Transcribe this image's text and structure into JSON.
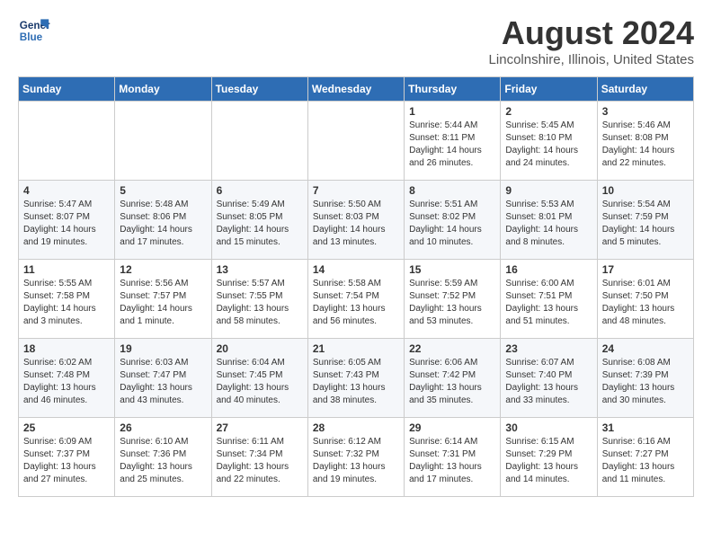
{
  "logo": {
    "line1": "General",
    "line2": "Blue"
  },
  "title": "August 2024",
  "location": "Lincolnshire, Illinois, United States",
  "days_of_week": [
    "Sunday",
    "Monday",
    "Tuesday",
    "Wednesday",
    "Thursday",
    "Friday",
    "Saturday"
  ],
  "weeks": [
    [
      {
        "day": "",
        "info": ""
      },
      {
        "day": "",
        "info": ""
      },
      {
        "day": "",
        "info": ""
      },
      {
        "day": "",
        "info": ""
      },
      {
        "day": "1",
        "info": "Sunrise: 5:44 AM\nSunset: 8:11 PM\nDaylight: 14 hours\nand 26 minutes."
      },
      {
        "day": "2",
        "info": "Sunrise: 5:45 AM\nSunset: 8:10 PM\nDaylight: 14 hours\nand 24 minutes."
      },
      {
        "day": "3",
        "info": "Sunrise: 5:46 AM\nSunset: 8:08 PM\nDaylight: 14 hours\nand 22 minutes."
      }
    ],
    [
      {
        "day": "4",
        "info": "Sunrise: 5:47 AM\nSunset: 8:07 PM\nDaylight: 14 hours\nand 19 minutes."
      },
      {
        "day": "5",
        "info": "Sunrise: 5:48 AM\nSunset: 8:06 PM\nDaylight: 14 hours\nand 17 minutes."
      },
      {
        "day": "6",
        "info": "Sunrise: 5:49 AM\nSunset: 8:05 PM\nDaylight: 14 hours\nand 15 minutes."
      },
      {
        "day": "7",
        "info": "Sunrise: 5:50 AM\nSunset: 8:03 PM\nDaylight: 14 hours\nand 13 minutes."
      },
      {
        "day": "8",
        "info": "Sunrise: 5:51 AM\nSunset: 8:02 PM\nDaylight: 14 hours\nand 10 minutes."
      },
      {
        "day": "9",
        "info": "Sunrise: 5:53 AM\nSunset: 8:01 PM\nDaylight: 14 hours\nand 8 minutes."
      },
      {
        "day": "10",
        "info": "Sunrise: 5:54 AM\nSunset: 7:59 PM\nDaylight: 14 hours\nand 5 minutes."
      }
    ],
    [
      {
        "day": "11",
        "info": "Sunrise: 5:55 AM\nSunset: 7:58 PM\nDaylight: 14 hours\nand 3 minutes."
      },
      {
        "day": "12",
        "info": "Sunrise: 5:56 AM\nSunset: 7:57 PM\nDaylight: 14 hours\nand 1 minute."
      },
      {
        "day": "13",
        "info": "Sunrise: 5:57 AM\nSunset: 7:55 PM\nDaylight: 13 hours\nand 58 minutes."
      },
      {
        "day": "14",
        "info": "Sunrise: 5:58 AM\nSunset: 7:54 PM\nDaylight: 13 hours\nand 56 minutes."
      },
      {
        "day": "15",
        "info": "Sunrise: 5:59 AM\nSunset: 7:52 PM\nDaylight: 13 hours\nand 53 minutes."
      },
      {
        "day": "16",
        "info": "Sunrise: 6:00 AM\nSunset: 7:51 PM\nDaylight: 13 hours\nand 51 minutes."
      },
      {
        "day": "17",
        "info": "Sunrise: 6:01 AM\nSunset: 7:50 PM\nDaylight: 13 hours\nand 48 minutes."
      }
    ],
    [
      {
        "day": "18",
        "info": "Sunrise: 6:02 AM\nSunset: 7:48 PM\nDaylight: 13 hours\nand 46 minutes."
      },
      {
        "day": "19",
        "info": "Sunrise: 6:03 AM\nSunset: 7:47 PM\nDaylight: 13 hours\nand 43 minutes."
      },
      {
        "day": "20",
        "info": "Sunrise: 6:04 AM\nSunset: 7:45 PM\nDaylight: 13 hours\nand 40 minutes."
      },
      {
        "day": "21",
        "info": "Sunrise: 6:05 AM\nSunset: 7:43 PM\nDaylight: 13 hours\nand 38 minutes."
      },
      {
        "day": "22",
        "info": "Sunrise: 6:06 AM\nSunset: 7:42 PM\nDaylight: 13 hours\nand 35 minutes."
      },
      {
        "day": "23",
        "info": "Sunrise: 6:07 AM\nSunset: 7:40 PM\nDaylight: 13 hours\nand 33 minutes."
      },
      {
        "day": "24",
        "info": "Sunrise: 6:08 AM\nSunset: 7:39 PM\nDaylight: 13 hours\nand 30 minutes."
      }
    ],
    [
      {
        "day": "25",
        "info": "Sunrise: 6:09 AM\nSunset: 7:37 PM\nDaylight: 13 hours\nand 27 minutes."
      },
      {
        "day": "26",
        "info": "Sunrise: 6:10 AM\nSunset: 7:36 PM\nDaylight: 13 hours\nand 25 minutes."
      },
      {
        "day": "27",
        "info": "Sunrise: 6:11 AM\nSunset: 7:34 PM\nDaylight: 13 hours\nand 22 minutes."
      },
      {
        "day": "28",
        "info": "Sunrise: 6:12 AM\nSunset: 7:32 PM\nDaylight: 13 hours\nand 19 minutes."
      },
      {
        "day": "29",
        "info": "Sunrise: 6:14 AM\nSunset: 7:31 PM\nDaylight: 13 hours\nand 17 minutes."
      },
      {
        "day": "30",
        "info": "Sunrise: 6:15 AM\nSunset: 7:29 PM\nDaylight: 13 hours\nand 14 minutes."
      },
      {
        "day": "31",
        "info": "Sunrise: 6:16 AM\nSunset: 7:27 PM\nDaylight: 13 hours\nand 11 minutes."
      }
    ]
  ]
}
